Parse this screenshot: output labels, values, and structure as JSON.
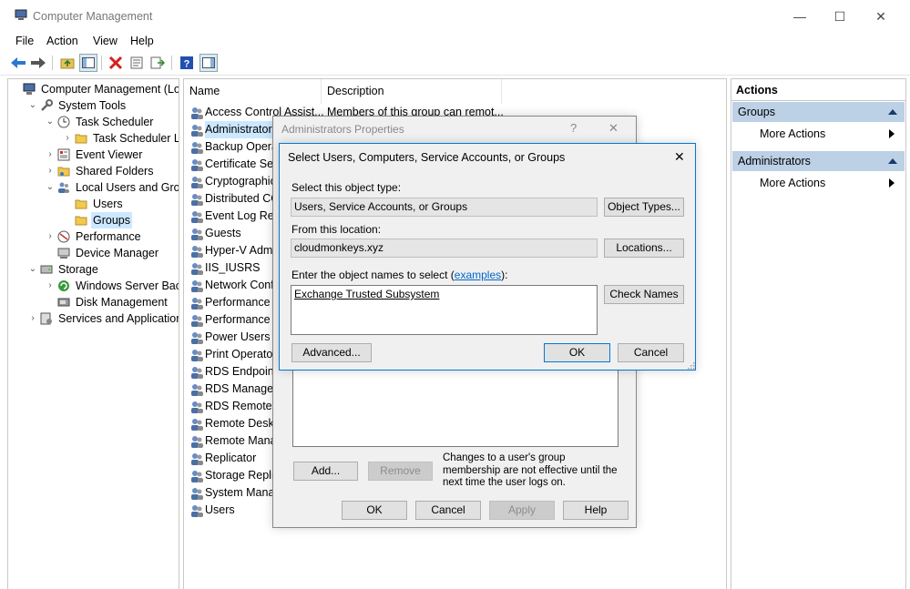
{
  "window": {
    "title": "Computer Management",
    "minimize": "—",
    "maximize": "☐",
    "close": "✕"
  },
  "menu": [
    "File",
    "Action",
    "View",
    "Help"
  ],
  "tree": [
    {
      "label": "Computer Management (Local",
      "indent": 0,
      "exp": "",
      "icon": "computer-icon"
    },
    {
      "label": "System Tools",
      "indent": 1,
      "exp": "v",
      "icon": "tools-icon"
    },
    {
      "label": "Task Scheduler",
      "indent": 2,
      "exp": "v",
      "icon": "clock-icon"
    },
    {
      "label": "Task Scheduler Library",
      "indent": 3,
      "exp": ">",
      "icon": "folder-icon"
    },
    {
      "label": "Event Viewer",
      "indent": 2,
      "exp": ">",
      "icon": "event-viewer-icon"
    },
    {
      "label": "Shared Folders",
      "indent": 2,
      "exp": ">",
      "icon": "shared-folder-icon"
    },
    {
      "label": "Local Users and Groups",
      "indent": 2,
      "exp": "v",
      "icon": "users-icon"
    },
    {
      "label": "Users",
      "indent": 3,
      "exp": "",
      "icon": "folder-icon"
    },
    {
      "label": "Groups",
      "indent": 3,
      "exp": "",
      "icon": "folder-icon",
      "selected": true
    },
    {
      "label": "Performance",
      "indent": 2,
      "exp": ">",
      "icon": "performance-icon"
    },
    {
      "label": "Device Manager",
      "indent": 2,
      "exp": "",
      "icon": "device-manager-icon"
    },
    {
      "label": "Storage",
      "indent": 1,
      "exp": "v",
      "icon": "storage-icon"
    },
    {
      "label": "Windows Server Backup",
      "indent": 2,
      "exp": ">",
      "icon": "backup-icon"
    },
    {
      "label": "Disk Management",
      "indent": 2,
      "exp": "",
      "icon": "disk-icon"
    },
    {
      "label": "Services and Applications",
      "indent": 1,
      "exp": ">",
      "icon": "services-icon"
    }
  ],
  "list": {
    "headers": {
      "name": "Name",
      "description": "Description"
    },
    "first_row": {
      "name": "Access Control Assist...",
      "description": "Members of this group can remot..."
    },
    "groups": [
      "Administrators",
      "Backup Operat",
      "Certificate Serv",
      "Cryptographic",
      "Distributed CO",
      "Event Log Rea",
      "Guests",
      "Hyper-V Admi",
      "IIS_IUSRS",
      "Network Confi",
      "Performance L",
      "Performance M",
      "Power Users",
      "Print Operator",
      "RDS Endpoint",
      "RDS Managem",
      "RDS Remote A",
      "Remote Deskto",
      "Remote Mana",
      "Replicator",
      "Storage Replic",
      "System Manag",
      "Users"
    ]
  },
  "actions": {
    "title": "Actions",
    "sections": [
      {
        "label": "Groups",
        "item": "More Actions"
      },
      {
        "label": "Administrators",
        "item": "More Actions"
      }
    ]
  },
  "props_dialog": {
    "title": "Administrators Properties",
    "help": "?",
    "close": "✕",
    "add": "Add...",
    "remove": "Remove",
    "note": "Changes to a user's group membership are not effective until the next time the user logs on.",
    "ok": "OK",
    "cancel": "Cancel",
    "apply": "Apply",
    "help_btn": "Help"
  },
  "select_dialog": {
    "title": "Select Users, Computers, Service Accounts, or Groups",
    "close": "✕",
    "object_type_label": "Select this object type:",
    "object_type_value": "Users, Service Accounts, or Groups",
    "object_types_btn": "Object Types...",
    "location_label": "From this location:",
    "location_value": "cloudmonkeys.xyz",
    "locations_btn": "Locations...",
    "names_label_pre": "Enter the object names to select (",
    "names_label_link": "examples",
    "names_label_post": "):",
    "names_value": "Exchange Trusted Subsystem",
    "check_names_btn": "Check Names",
    "advanced_btn": "Advanced...",
    "ok": "OK",
    "cancel": "Cancel"
  },
  "colors": {
    "selection": "#cce8ff",
    "accent": "#0078d7",
    "section": "#bcd0e6"
  }
}
